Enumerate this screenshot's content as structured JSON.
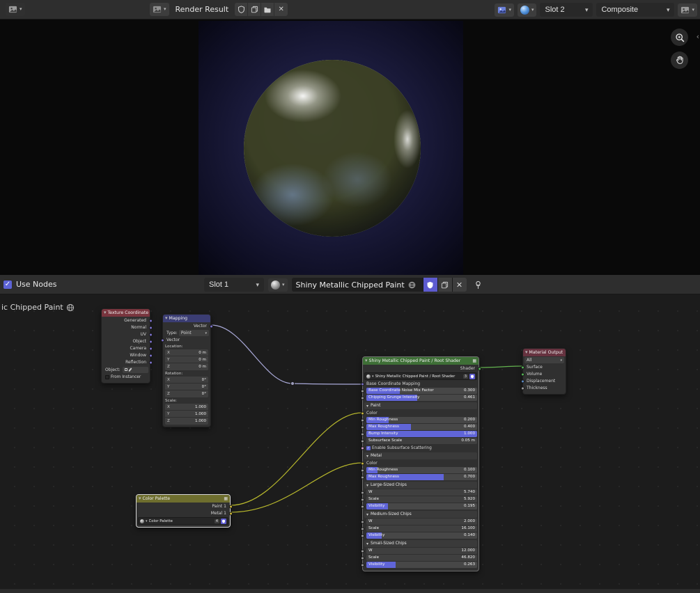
{
  "colors": {
    "accent": "#5d63d6",
    "slider_fill": "#6065d8",
    "header_texture_coordinate": "#79353e",
    "header_mapping": "#3b3d73",
    "header_group": "#3e6f36",
    "header_palette": "#6e6e2e",
    "header_material_output": "#66323f",
    "socket_vector": "#7a70c9",
    "socket_color": "#c9b53a",
    "socket_shader": "#54b354",
    "socket_float": "#9e9e9e",
    "socket_bool": "#d8a0c8",
    "socket_blue": "#5d8ac2",
    "wire_vector": "#a9a9d8",
    "wire_color": "#b9b92c",
    "wire_shader": "#63b34f"
  },
  "image_editor_header": {
    "image_name": "Render Result",
    "slot": "Slot 2",
    "pass": "Composite"
  },
  "shader_header": {
    "use_nodes_label": "Use Nodes",
    "slot": "Slot 1",
    "material_name": "Shiny Metallic Chipped Paint"
  },
  "node_editor": {
    "breadcrumb": "ic Chipped Paint",
    "nodes": {
      "texture_coordinate": {
        "title": "Texture Coordinate",
        "outputs": [
          "Generated",
          "Normal",
          "UV",
          "Object",
          "Camera",
          "Window",
          "Reflection"
        ],
        "object_label": "Object:",
        "from_instancer_label": "From Instancer"
      },
      "mapping": {
        "title": "Mapping",
        "output": "Vector",
        "type_label": "Type:",
        "type_value": "Point",
        "vector_input": "Vector",
        "groups": [
          {
            "label": "Location:",
            "fields": [
              {
                "axis": "X",
                "value": "0 m"
              },
              {
                "axis": "Y",
                "value": "0 m"
              },
              {
                "axis": "Z",
                "value": "0 m"
              }
            ]
          },
          {
            "label": "Rotation:",
            "fields": [
              {
                "axis": "X",
                "value": "0°"
              },
              {
                "axis": "Y",
                "value": "0°"
              },
              {
                "axis": "Z",
                "value": "0°"
              }
            ]
          },
          {
            "label": "Scale:",
            "fields": [
              {
                "axis": "X",
                "value": "1.000"
              },
              {
                "axis": "Y",
                "value": "1.000"
              },
              {
                "axis": "Z",
                "value": "1.000"
              }
            ]
          }
        ]
      },
      "root_shader": {
        "title": "Shiny Metallic Chipped Paint / Root Shader",
        "rows": [
          {
            "type": "output",
            "label": "Shader"
          },
          {
            "type": "datablock",
            "name": "Shiny Metallic Chipped Paint / Root Shader",
            "users": "3"
          },
          {
            "type": "input",
            "label": "Base Coordinate Mapping",
            "socket": "vector"
          },
          {
            "type": "slider",
            "label": "Base Coordinate Noise Mix Factor",
            "value": "0.300",
            "fill": 0.3
          },
          {
            "type": "slider",
            "label": "Chipping Grunge Intensity",
            "value": "0.461",
            "fill": 0.461
          },
          {
            "type": "section",
            "label": "Paint"
          },
          {
            "type": "input",
            "label": "Color",
            "socket": "color"
          },
          {
            "type": "slider",
            "label": "Min Roughness",
            "value": "0.200",
            "fill": 0.2
          },
          {
            "type": "slider",
            "label": "Max Roughness",
            "value": "0.400",
            "fill": 0.4
          },
          {
            "type": "slider",
            "label": "Bump Intensity",
            "value": "1.000",
            "fill": 1
          },
          {
            "type": "field",
            "label": "Subsurface Scale",
            "value": "0.05 m"
          },
          {
            "type": "checkbox",
            "label": "Enable Subsurface Scattering",
            "checked": true
          },
          {
            "type": "section",
            "label": "Metal"
          },
          {
            "type": "input",
            "label": "Color",
            "socket": "color"
          },
          {
            "type": "slider",
            "label": "Min Roughness",
            "value": "0.100",
            "fill": 0.1
          },
          {
            "type": "slider",
            "label": "Max Roughness",
            "value": "0.700",
            "fill": 0.7
          },
          {
            "type": "section",
            "label": "Large-Sized Chips"
          },
          {
            "type": "field",
            "label": "W",
            "value": "5.740"
          },
          {
            "type": "field",
            "label": "Scale",
            "value": "5.920"
          },
          {
            "type": "slider",
            "label": "Visibility",
            "value": "0.195",
            "fill": 0.195
          },
          {
            "type": "section",
            "label": "Medium-Sized Chips"
          },
          {
            "type": "field",
            "label": "W",
            "value": "2.000"
          },
          {
            "type": "field",
            "label": "Scale",
            "value": "16.100"
          },
          {
            "type": "slider",
            "label": "Visibility",
            "value": "0.140",
            "fill": 0.14
          },
          {
            "type": "section",
            "label": "Small-Sized Chips"
          },
          {
            "type": "field",
            "label": "W",
            "value": "12.000"
          },
          {
            "type": "field",
            "label": "Scale",
            "value": "46.820"
          },
          {
            "type": "slider",
            "label": "Visibility",
            "value": "0.263",
            "fill": 0.263
          }
        ]
      },
      "color_palette": {
        "title": "Color Palette",
        "outputs": [
          {
            "label": "Paint 1",
            "socket": "color"
          },
          {
            "label": "Metal 1",
            "socket": "color"
          }
        ],
        "datablock": {
          "name": "Color Palette",
          "users": "4"
        }
      },
      "material_output": {
        "title": "Material Output",
        "target": "All",
        "inputs": [
          {
            "label": "Surface",
            "socket": "shader"
          },
          {
            "label": "Volume",
            "socket": "shader"
          },
          {
            "label": "Displacement",
            "socket": "blue"
          },
          {
            "label": "Thickness",
            "socket": "float"
          }
        ]
      }
    }
  },
  "icons": {
    "fake_user": "shield",
    "duplicate": "copy-pages",
    "open_image": "folder",
    "unlink": "x",
    "pin": "thumbtack",
    "zoom": "magnifier-plus",
    "pan": "hand",
    "material_preview": "sphere",
    "dropdown": "caret-down"
  }
}
